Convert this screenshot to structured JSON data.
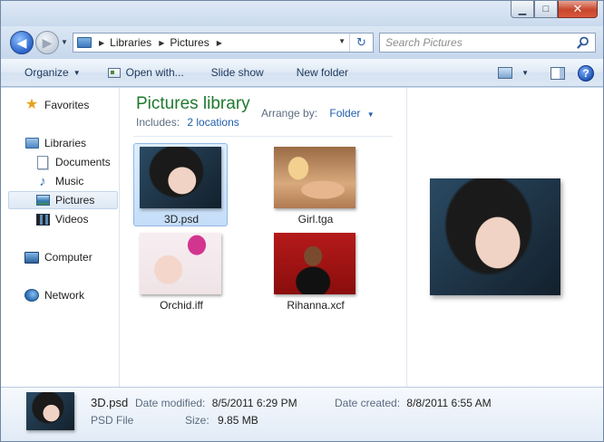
{
  "window": {
    "minimize_glyph": "▁",
    "maximize_glyph": "□",
    "close_glyph": "✕"
  },
  "address": {
    "crumbs": [
      "Libraries",
      "Pictures"
    ],
    "search_placeholder": "Search Pictures"
  },
  "toolbar": {
    "organize": "Organize",
    "open_with": "Open with...",
    "slide_show": "Slide show",
    "new_folder": "New folder",
    "help": "?"
  },
  "nav": {
    "favorites": "Favorites",
    "libraries": "Libraries",
    "documents": "Documents",
    "music": "Music",
    "pictures": "Pictures",
    "videos": "Videos",
    "computer": "Computer",
    "network": "Network"
  },
  "library": {
    "title": "Pictures library",
    "includes_label": "Includes:",
    "includes_link": "2 locations",
    "arrange_label": "Arrange by:",
    "arrange_value": "Folder"
  },
  "files": [
    {
      "name": "3D.psd",
      "selected": true
    },
    {
      "name": "Girl.tga",
      "selected": false
    },
    {
      "name": "Orchid.iff",
      "selected": false
    },
    {
      "name": "Rihanna.xcf",
      "selected": false
    }
  ],
  "details": {
    "name": "3D.psd",
    "type": "PSD File",
    "modified_label": "Date modified:",
    "modified_value": "8/5/2011 6:29 PM",
    "created_label": "Date created:",
    "created_value": "8/8/2011 6:55 AM",
    "size_label": "Size:",
    "size_value": "9.85 MB"
  },
  "colors": {
    "library_title": "#1e7a2e",
    "link": "#1f5fad",
    "close_button": "#c7462c"
  }
}
